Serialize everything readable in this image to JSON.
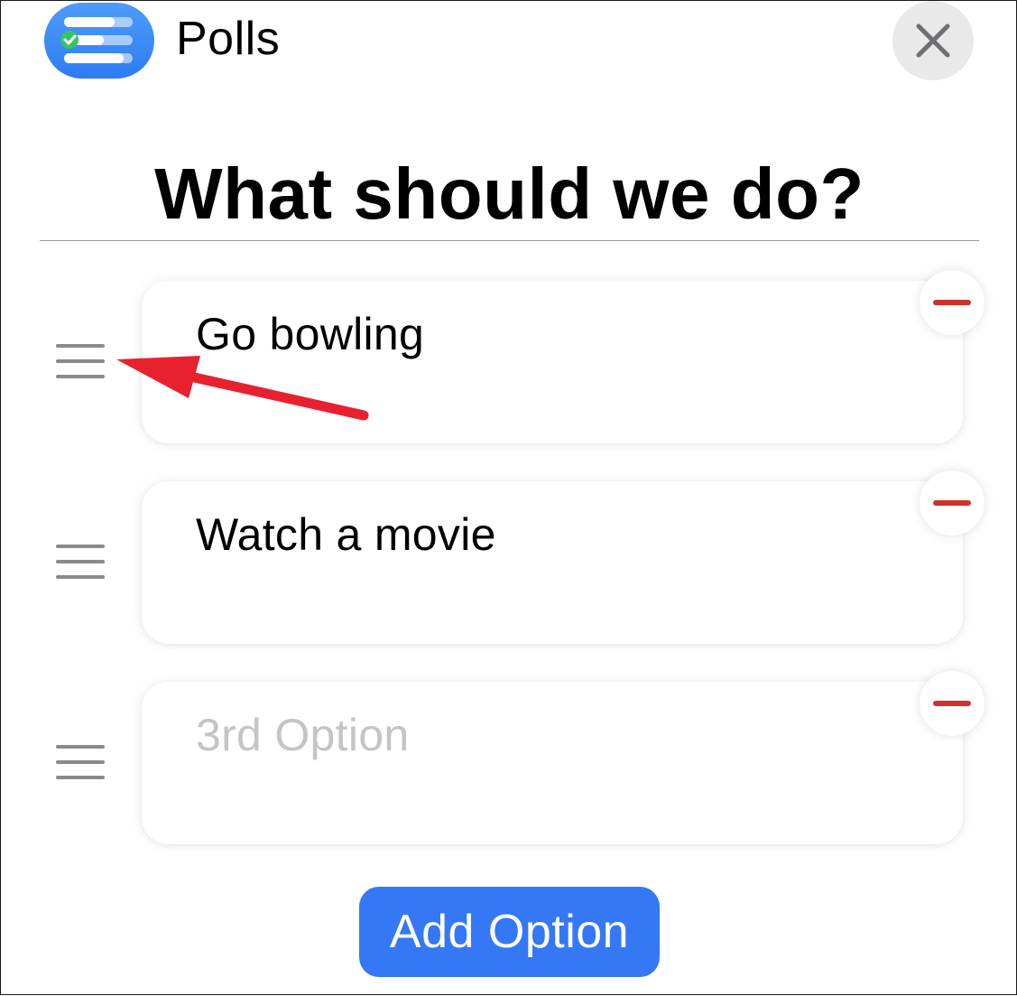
{
  "header": {
    "app_title": "Polls",
    "close_icon": "close-icon",
    "app_icon": "polls-app-icon"
  },
  "poll": {
    "question": "What should we do?",
    "options": [
      {
        "value": "Go bowling",
        "placeholder": ""
      },
      {
        "value": "Watch a movie",
        "placeholder": ""
      },
      {
        "value": "",
        "placeholder": "3rd Option"
      }
    ]
  },
  "actions": {
    "add_option_label": "Add Option"
  },
  "colors": {
    "accent": "#3478f6",
    "remove": "#d0302b",
    "annotation_arrow": "#e8212f",
    "handle": "#8a8a8d"
  }
}
